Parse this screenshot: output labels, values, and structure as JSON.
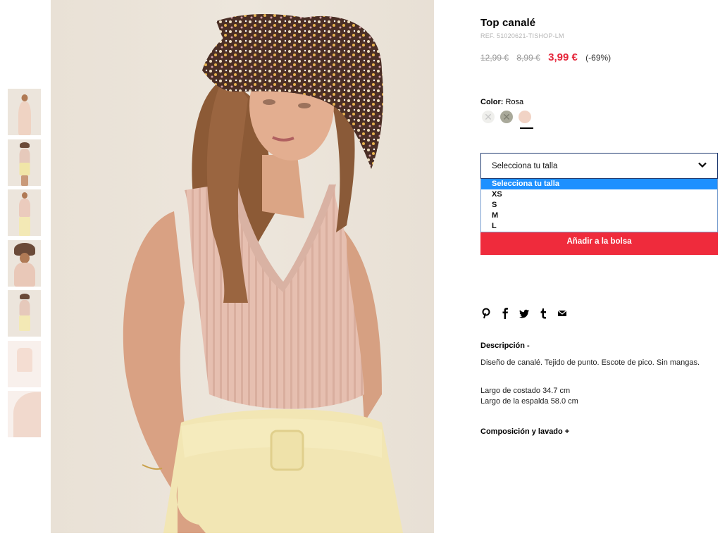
{
  "product": {
    "title": "Top canalé",
    "ref": "REF. 51020621-TISHOP-LM",
    "price_old_1": "12,99 €",
    "price_old_2": "8,99 €",
    "price_new": "3,99 €",
    "discount": "(-69%)"
  },
  "color": {
    "label": "Color:",
    "value": "Rosa",
    "swatches": [
      {
        "name": "white",
        "hex": "#efefec",
        "unavailable": true
      },
      {
        "name": "olive",
        "hex": "#a9a99a",
        "unavailable": true
      },
      {
        "name": "rosa",
        "hex": "#f1d3c5",
        "unavailable": false
      }
    ]
  },
  "size_select": {
    "current": "Selecciona tu talla",
    "options": [
      "Selecciona tu talla",
      "XS",
      "S",
      "M",
      "L"
    ],
    "highlighted": "Selecciona tu talla"
  },
  "add_to_bag": "Añadir a la bolsa",
  "social_icons": [
    "pinterest-icon",
    "facebook-icon",
    "twitter-icon",
    "tumblr-icon",
    "email-icon"
  ],
  "description": {
    "heading": "Descripción -",
    "text": "Diseño de canalé. Tejido de punto. Escote de pico. Sin mangas.",
    "measure1": "Largo de costado 34.7 cm",
    "measure2": "Largo de la espalda 58.0 cm"
  },
  "composition": {
    "heading": "Composición y lavado +"
  },
  "thumbnails": [
    "front-half",
    "full-body-hat",
    "full-body",
    "hat-closeup",
    "full-body-hat-2",
    "product-flat",
    "product-detail"
  ],
  "colors": {
    "sale_red": "#e5263a",
    "button_red": "#ef2b3c",
    "select_highlight": "#1e90ff"
  }
}
